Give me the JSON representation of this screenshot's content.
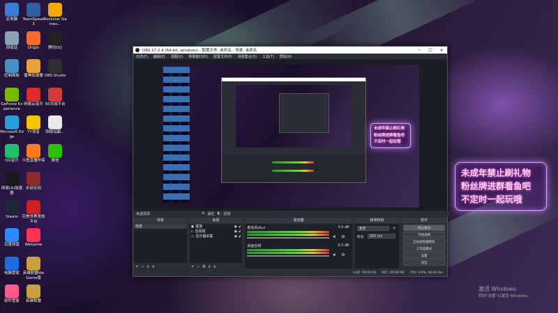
{
  "desktop_icons": [
    {
      "id": "pc",
      "label": "此电脑",
      "icon": "monitor-icon",
      "color": "#3a7bd5",
      "col": 0,
      "row": 0
    },
    {
      "id": "teamspeak",
      "label": "TeamSpeak 3",
      "icon": "teamspeak-icon",
      "color": "#2f5f9f",
      "col": 1,
      "row": 0
    },
    {
      "id": "rockstar",
      "label": "Rockstar Games...",
      "icon": "rockstar-icon",
      "color": "#f2a900",
      "col": 2,
      "row": 0
    },
    {
      "id": "recycle",
      "label": "回收站",
      "icon": "recycle-bin-icon",
      "color": "#8aa2b8",
      "col": 0,
      "row": 1
    },
    {
      "id": "origin",
      "label": "Origin",
      "icon": "origin-icon",
      "color": "#f56c2d",
      "col": 1,
      "row": 1
    },
    {
      "id": "tencentqq",
      "label": "腾讯QQ",
      "icon": "qq-icon",
      "color": "#222222",
      "col": 2,
      "row": 1
    },
    {
      "id": "control",
      "label": "控制面板",
      "icon": "control-panel-icon",
      "color": "#4a90c8",
      "col": 0,
      "row": 2
    },
    {
      "id": "leishen",
      "label": "雷神加速器",
      "icon": "leishen-icon",
      "color": "#e8a23a",
      "col": 1,
      "row": 2
    },
    {
      "id": "obs",
      "label": "OBS Studio",
      "icon": "obs-icon",
      "color": "#302e31",
      "col": 2,
      "row": 2
    },
    {
      "id": "geforce",
      "label": "GeForce Experience",
      "icon": "geforce-icon",
      "color": "#76b900",
      "col": 0,
      "row": 3
    },
    {
      "id": "neteasemusic",
      "label": "网易云音乐",
      "icon": "netease-music-icon",
      "color": "#e02b2b",
      "col": 1,
      "row": 3
    },
    {
      "id": "5e",
      "label": "5E对战平台",
      "icon": "5e-icon",
      "color": "#d33c3c",
      "col": 2,
      "row": 3
    },
    {
      "id": "edge",
      "label": "Microsoft Edge",
      "icon": "edge-icon",
      "color": "#2aa0d8",
      "col": 0,
      "row": 4
    },
    {
      "id": "yy",
      "label": "YY语音",
      "icon": "yy-icon",
      "color": "#f5c400",
      "col": 1,
      "row": 4
    },
    {
      "id": "bak",
      "label": "回收站副...",
      "icon": "file-icon",
      "color": "#e8e8e8",
      "col": 2,
      "row": 4
    },
    {
      "id": "qqmusic",
      "label": "QQ音乐",
      "icon": "qq-music-icon",
      "color": "#1fbf6b",
      "col": 0,
      "row": 5
    },
    {
      "id": "douyu",
      "label": "斗鱼直播伴侣",
      "icon": "douyu-icon",
      "color": "#ff7a1a",
      "col": 1,
      "row": 5
    },
    {
      "id": "wechat",
      "label": "微信",
      "icon": "wechat-icon",
      "color": "#2dc100",
      "col": 2,
      "row": 5
    },
    {
      "id": "uu",
      "label": "网易UU加速器",
      "icon": "uu-icon",
      "color": "#1a1a1a",
      "col": 0,
      "row": 6
    },
    {
      "id": "yongjie",
      "label": "永劫无间",
      "icon": "yongjie-icon",
      "color": "#8a2a2a",
      "col": 1,
      "row": 6
    },
    {
      "id": "steam",
      "label": "Steam",
      "icon": "steam-icon",
      "color": "#1b2838",
      "col": 0,
      "row": 7
    },
    {
      "id": "lolcn",
      "label": "完美世界竞技平台",
      "icon": "perfect-world-icon",
      "color": "#c22",
      "col": 1,
      "row": 7
    },
    {
      "id": "baidunetdisk",
      "label": "百度网盘",
      "icon": "baidu-netdisk-icon",
      "color": "#2a8cff",
      "col": 0,
      "row": 8
    },
    {
      "id": "wegame",
      "label": "WeGame",
      "icon": "wegame-icon",
      "color": "#ff3355",
      "col": 1,
      "row": 8
    },
    {
      "id": "pcmanager",
      "label": "电脑管家",
      "icon": "pc-manager-icon",
      "color": "#1e6de0",
      "col": 0,
      "row": 9
    },
    {
      "id": "lolwegame",
      "label": "英雄联盟WeGame版",
      "icon": "lol-icon",
      "color": "#c8a040",
      "col": 1,
      "row": 9
    },
    {
      "id": "softmgr",
      "label": "软件管家",
      "icon": "software-manager-icon",
      "color": "#ff5a8c",
      "col": 0,
      "row": 10
    },
    {
      "id": "lol",
      "label": "英雄联盟",
      "icon": "lol-icon",
      "color": "#c8a040",
      "col": 1,
      "row": 10
    }
  ],
  "banner": {
    "lines": [
      "未成年禁止刷礼物",
      "粉丝牌进群看鱼吧",
      "不定时一起玩哦"
    ]
  },
  "obs": {
    "title": "OBS 27.2.4 (64-bit, windows) - 配置文件: 未命名 - 场景: 未命名",
    "menu": [
      "文件(F)",
      "编辑(E)",
      "视图(V)",
      "停靠窗口(D)",
      "配置文件(P)",
      "场景集合(S)",
      "工具(T)",
      "帮助(H)"
    ],
    "source_bar": {
      "label": "未选择源",
      "props": "属性",
      "filters": "滤镜"
    },
    "docks": {
      "scenes": {
        "title": "场景",
        "items": [
          "场景"
        ]
      },
      "sources": {
        "title": "来源",
        "items": [
          "图像",
          "音视频",
          "显示器采集"
        ]
      },
      "mixer": {
        "title": "混音器",
        "channels": [
          {
            "name": "麦克风/Aux",
            "db": "0.0 dB"
          },
          {
            "name": "桌面音频",
            "db": "0.0 dB"
          }
        ]
      },
      "transitions": {
        "title": "转场特效",
        "type": "渐变",
        "duration_label": "时长",
        "duration": "300 ms"
      },
      "controls": {
        "title": "控件",
        "buttons": [
          "停止推流",
          "开始录制",
          "启动虚拟摄像机",
          "工作室模式",
          "设置",
          "退出"
        ]
      }
    },
    "status": {
      "live": "LIVE: 00:00:00",
      "rec": "REC: 00:00:00",
      "cpu": "CPU: 0.9%, 60.00 fps"
    }
  },
  "watermark": {
    "line1": "激活 Windows",
    "line2": "转到\"设置\"以激活 Windows。"
  },
  "colors": {
    "accent": "#d8a8ff",
    "obs_bg": "#2b2e38",
    "banner_text": "#ffd2f4"
  }
}
